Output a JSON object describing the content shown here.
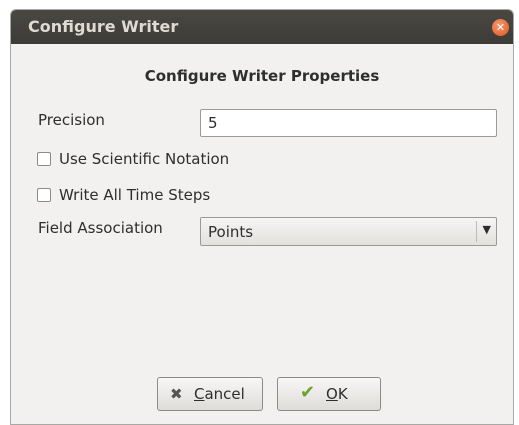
{
  "window": {
    "title": "Configure Writer"
  },
  "dialog": {
    "heading": "Configure Writer Properties",
    "precision": {
      "label": "Precision",
      "value": "5"
    },
    "scientific_notation": {
      "label": "Use Scientific Notation",
      "checked": false
    },
    "write_all_time_steps": {
      "label": "Write All Time Steps",
      "checked": false
    },
    "field_association": {
      "label": "Field Association",
      "selected": "Points"
    },
    "buttons": {
      "cancel": {
        "label": "Cancel",
        "mnemonic": "C",
        "rest": "ancel",
        "icon": "cancel-x-icon"
      },
      "ok": {
        "label": "OK",
        "mnemonic": "O",
        "rest": "K",
        "icon": "checkmark-icon"
      }
    }
  },
  "colors": {
    "titlebar": "#3d3b37",
    "close_button": "#e2531e",
    "background": "#f2f1f0"
  }
}
